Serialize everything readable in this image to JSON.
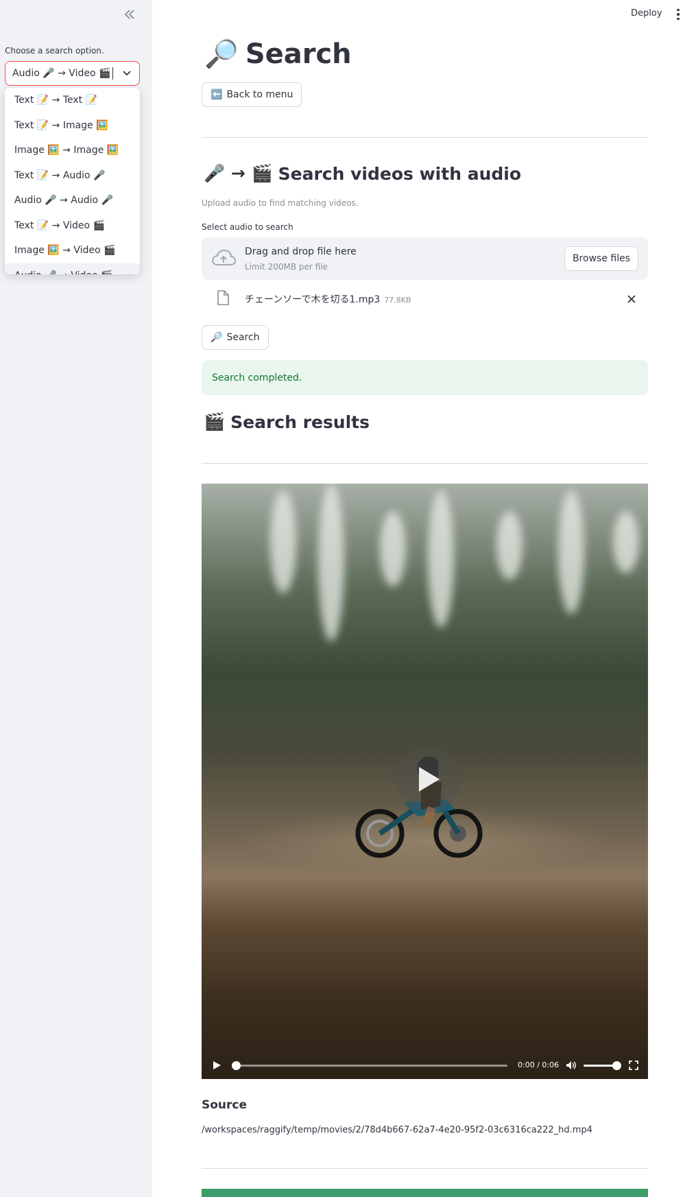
{
  "header": {
    "deploy_label": "Deploy",
    "menu_icon": "kebab-menu-icon"
  },
  "sidebar": {
    "collapse_icon": "double-chevron-left-icon",
    "select_label": "Choose a search option.",
    "selected_value": "Audio 🎤 → Video 🎬",
    "options": [
      "Text 📝 → Text 📝",
      "Text 📝 → Image 🖼️",
      "Image 🖼️ → Image 🖼️",
      "Text 📝 → Audio 🎤",
      "Audio 🎤 → Audio 🎤",
      "Text 📝 → Video 🎬",
      "Image 🖼️ → Video 🎬",
      "Audio 🎤 → Video 🎬"
    ],
    "accent_color": "#ff4b4b"
  },
  "main": {
    "title_icon": "🔎",
    "title": "Search",
    "back_button": {
      "icon": "⬅️",
      "label": "Back to menu"
    },
    "section": {
      "icon": "🎤 → 🎬",
      "title": "Search videos with audio",
      "caption": "Upload audio to find matching videos."
    },
    "uploader": {
      "label": "Select audio to search",
      "drop_text": "Drag and drop file here",
      "limit_text": "Limit 200MB per file",
      "browse_label": "Browse files"
    },
    "file": {
      "name": "チェーンソーで木を切る1.mp3",
      "size": "77.8KB"
    },
    "search_button": {
      "icon": "🔎",
      "label": "Search"
    },
    "status": {
      "text": "Search completed.",
      "color": "#177233"
    },
    "results": {
      "icon": "🎬",
      "title": "Search results"
    },
    "video": {
      "time": "0:00 / 0:06",
      "progress": 0.0,
      "volume": 1.0
    },
    "source": {
      "heading": "Source",
      "path": "/workspaces/raggify/temp/movies/2/78d4b667-62a7-4e20-95f2-03c6316ca222_hd.mp4"
    }
  }
}
